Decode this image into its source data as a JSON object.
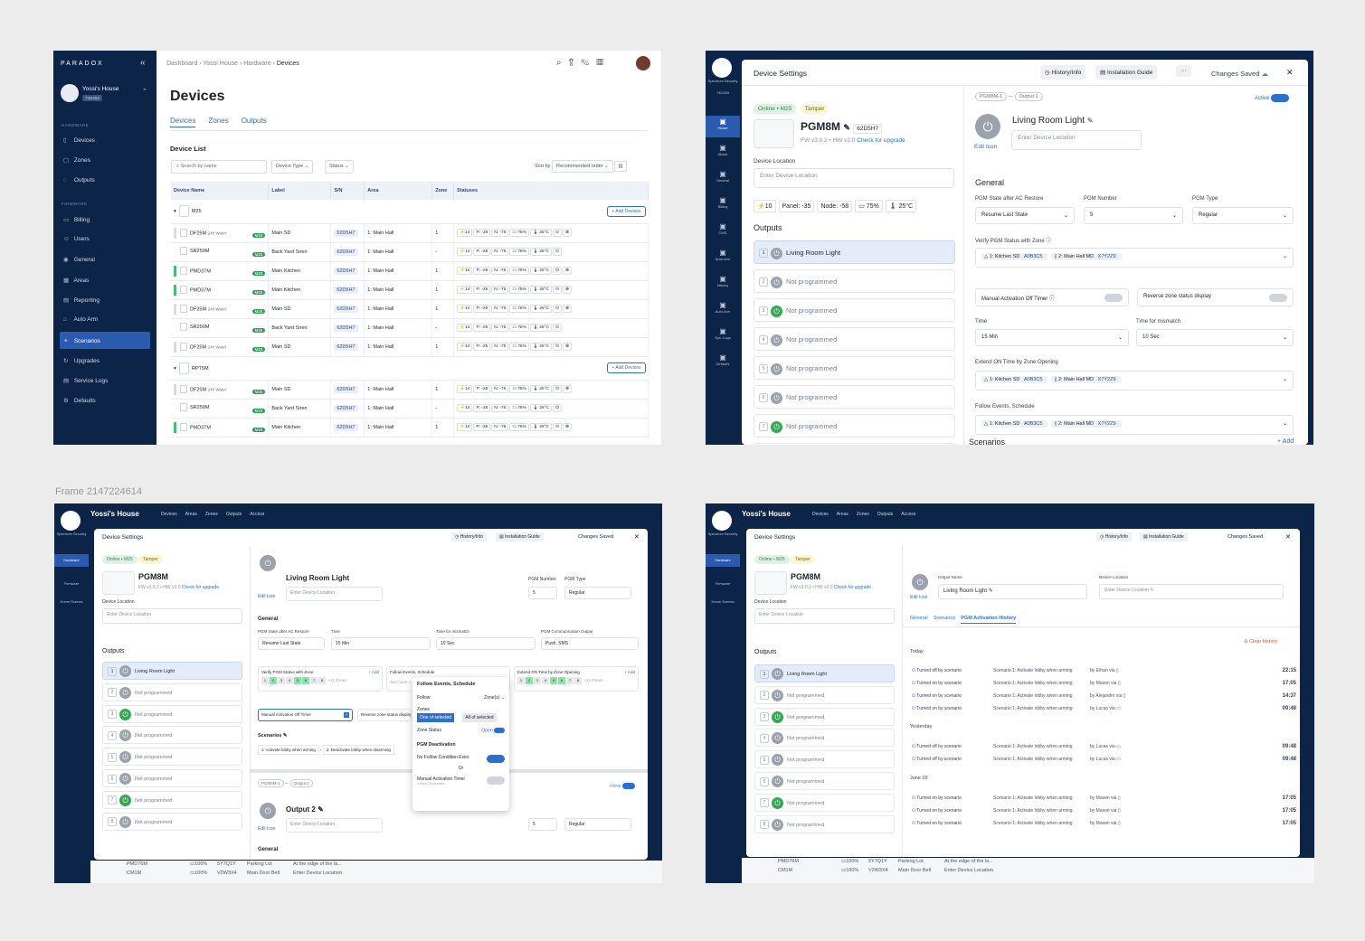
{
  "frame_caption": "Frame 2147224614",
  "f1": {
    "logo": "PARADOX",
    "house": {
      "name": "Yossi's House",
      "id": "74D459"
    },
    "sections": [
      "HARDWARE",
      "FIRMWARE"
    ],
    "nav": [
      {
        "label": "Devices",
        "icon": "▯"
      },
      {
        "label": "Zones",
        "icon": "▢"
      },
      {
        "label": "Outputs",
        "icon": "◌"
      },
      {
        "label": "Billing",
        "icon": "▭"
      },
      {
        "label": "Users",
        "icon": "☺"
      },
      {
        "label": "General",
        "icon": "◉"
      },
      {
        "label": "Areas",
        "icon": "▦"
      },
      {
        "label": "Reporting",
        "icon": "▤"
      },
      {
        "label": "Auto Arm",
        "icon": "⌂"
      },
      {
        "label": "Scenarios",
        "icon": "✦"
      },
      {
        "label": "Upgrades",
        "icon": "↻"
      },
      {
        "label": "Service Logs",
        "icon": "▤"
      },
      {
        "label": "Defaults",
        "icon": "⚙"
      }
    ],
    "breadcrumb": [
      "Dashboard",
      "Yossi House",
      "Hardware",
      "Devices"
    ],
    "title": "Devices",
    "tabs": [
      "Devices",
      "Zones",
      "Outputs"
    ],
    "list_title": "Device List",
    "search_placeholder": "Search by name",
    "filters": [
      "Device Type",
      "Status"
    ],
    "sort_label": "Sort by",
    "sort_value": "Recommended order",
    "columns": [
      "Device Name",
      "Label",
      "S/N",
      "Area",
      "Zone",
      "Statuses"
    ],
    "groups": [
      {
        "name": "M25",
        "add": "+ Add Devices",
        "rows": [
          {
            "n": "DF25M",
            "extra": "24h Water",
            "tag": "M25",
            "label": "Main SD",
            "sn": "62D5H7",
            "area": "1: Main Hall",
            "zone": "1",
            "bar": "x"
          },
          {
            "n": "SR250M",
            "extra": "",
            "tag": "M25",
            "label": "Back Yard Siren",
            "sn": "62D5H7",
            "area": "1: Main Hall",
            "zone": "-",
            "bar": ""
          },
          {
            "n": "PMD37M",
            "extra": "",
            "tag": "M25",
            "label": "Main Kitchen",
            "sn": "62D5H7",
            "area": "1: Main Hall",
            "zone": "1",
            "bar": "g"
          },
          {
            "n": "PMD37M",
            "extra": "",
            "tag": "M25",
            "label": "Main Kitchen",
            "sn": "62D5H7",
            "area": "1: Main Hall",
            "zone": "1",
            "bar": "g"
          },
          {
            "n": "DF25M",
            "extra": "24h Water",
            "tag": "M25",
            "label": "Main SD",
            "sn": "62D5H7",
            "area": "1: Main Hall",
            "zone": "1",
            "bar": "x"
          },
          {
            "n": "SR250M",
            "extra": "",
            "tag": "M25",
            "label": "Back Yard Siren",
            "sn": "62D5H7",
            "area": "1: Main Hall",
            "zone": "-",
            "bar": ""
          },
          {
            "n": "DF25M",
            "extra": "24h Water",
            "tag": "M25",
            "label": "Main SD",
            "sn": "62D5H7",
            "area": "1: Main Hall",
            "zone": "1",
            "bar": "x"
          }
        ]
      },
      {
        "name": "RPT5M",
        "add": "+ Add Devices",
        "rows": [
          {
            "n": "DF25M",
            "extra": "24h Water",
            "tag": "M25",
            "label": "Main SD",
            "sn": "62D5H7",
            "area": "1: Main Hall",
            "zone": "1",
            "bar": "x"
          },
          {
            "n": "SR250M",
            "extra": "",
            "tag": "M25",
            "label": "Back Yard Siren",
            "sn": "62D5H7",
            "area": "1: Main Hall",
            "zone": "-",
            "bar": ""
          },
          {
            "n": "PMD37M",
            "extra": "",
            "tag": "M25",
            "label": "Main Kitchen",
            "sn": "62D5H7",
            "area": "1: Main Hall",
            "zone": "1",
            "bar": "g"
          }
        ]
      }
    ],
    "status_chips": [
      "⚡14",
      "P: -25",
      "N: -75",
      "▭ 75%",
      "🌡 25°C",
      "⊙",
      "⊗"
    ]
  },
  "settings": {
    "brand": "Spectrum Security",
    "brand_id": "74D459",
    "title": "Device Settings",
    "history": "History/Info",
    "guide": "Installation Guide",
    "more": "···",
    "saved": "Changes Saved",
    "close": "✕",
    "online": "Online • M25",
    "tamper": "Tamper",
    "device": "PGM8M",
    "sn": "62D5H7",
    "fw": "FW v3.0.2 • HW v2.0",
    "upgrade": "Check for upgrade",
    "location_label": "Device Location",
    "location_ph": "Enter Device Location",
    "stats": [
      "⚡10",
      "Panel: -35",
      "Node: -58",
      "▭ 75%",
      "🌡 25°C"
    ],
    "outputs_title": "Outputs",
    "outputs": [
      "Living Room Light",
      "Not programmed",
      "Not programmed",
      "Not programmed",
      "Not programmed",
      "Not programmed",
      "Not programmed",
      "Not programmed"
    ],
    "crumb": [
      "PGM8M-1",
      "Output 1"
    ],
    "active": "Active",
    "out_name": "Living Room Light",
    "edit_icon": "Edit Icon",
    "general": "General",
    "ac_label": "PGM State after AC Restore",
    "ac_value": "Resume Last State",
    "pgm_num_label": "PGM Number",
    "pgm_num": "5",
    "pgm_type_label": "PGM Type",
    "pgm_type": "Regular",
    "verify_label": "Verify PGM Status with Zone",
    "zone1": "1: Kitchen SD",
    "zone1_id": "A0B3C5",
    "zone2": "2: Main Hall MD",
    "zone2_id": "X7Y2Z9",
    "manual_label": "Manual Activation Off Timer",
    "reverse_label": "Reverse zone status display",
    "time_label": "Time",
    "time_value": "15 Min",
    "mismatch_label": "Time for mismatch",
    "mismatch_value": "10 Sec",
    "extend_label": "Extend ON Time by Zone Opening",
    "follow_label": "Follow Events, Schedule",
    "scenarios": "Scenarios",
    "add": "+ Add",
    "nav2": [
      "Home",
      "About",
      "General",
      "Billing",
      "CMS",
      "Auto Arm",
      "History",
      "Auto Arm",
      "Sys. Logs",
      "Defaults"
    ]
  },
  "f3": {
    "house": "Yossi's House",
    "topnav": [
      "Devices",
      "Areas",
      "Zones",
      "Outputs",
      "Access"
    ],
    "nav": [
      "Hardware",
      "Firmware",
      "Home Scenes"
    ],
    "comm_label": "PGM Communication Output",
    "comm_value": "Push, SMS",
    "verify_add": "+ Add",
    "zone_count": "+12 Zones",
    "zones_nums": [
      "1",
      "2",
      "3",
      "4",
      "5",
      "6",
      "7",
      "8"
    ],
    "popup": {
      "title": "Follow Events, Schedule",
      "follow": "Follow",
      "follow_val": "Zone(s)",
      "zones": "Zones",
      "one": "One of selected",
      "all": "All of selected",
      "zone_status": "Zone Status",
      "open": "Open",
      "deact": "PGM Deactivation",
      "no_follow": "No Follow Condition Exist",
      "or": "Or",
      "manual": "Manual Activation Timer",
      "manual_sub": "1 hour 15 minutes"
    },
    "follow_ph": "See more c...",
    "scen": [
      "1: Activate lobby when arming",
      "2: Deactivate lobby when disarming"
    ],
    "out2": "Output 2",
    "out2_crumb": [
      "PGM8M-1",
      "Output 2"
    ],
    "bottom_rows": [
      {
        "n": "PMD76M",
        "b": "▭100%",
        "sn": "5Y7Q1Y",
        "l": "Parking Lot",
        "d": "At the edge of the la..."
      },
      {
        "n": "CM1M",
        "b": "▭100%",
        "sn": "V2W3X4",
        "l": "Main Door Bell",
        "d": "Enter Device Location"
      }
    ]
  },
  "f4": {
    "outname_label": "Output Name",
    "dev_loc_label": "Device Location",
    "tabs": [
      "General",
      "Scenarios",
      "PGM Activation History"
    ],
    "clear": "Clear history",
    "days": [
      "Today",
      "Yesterday",
      "June 03"
    ],
    "rows": [
      [
        {
          "a": "Turned off by scenario",
          "b": "Scenario 1: Activate lobby when arming",
          "u": "by Ethan via ▯",
          "t": "22:15"
        },
        {
          "a": "Turned on by scenario",
          "b": "Scenario 1: Activate lobby when arming",
          "u": "by Mason via ▯",
          "t": "17:05"
        },
        {
          "a": "Turned on by scenario",
          "b": "Scenario 1: Activate lobby when arming",
          "u": "by Alejandro via ▯",
          "t": "14:37"
        },
        {
          "a": "Turned on by scenario",
          "b": "Scenario 1: Activate lobby when arming",
          "u": "by Lucas via ▭",
          "t": "09:48"
        }
      ],
      [
        {
          "a": "Turned off by scenario",
          "b": "Scenario 1: Activate lobby when arming",
          "u": "by Lucas via ▭",
          "t": "09:48"
        },
        {
          "a": "Turned off by scenario",
          "b": "Scenario 1: Activate lobby when arming",
          "u": "by Lucas via ▭",
          "t": "09:48"
        }
      ],
      [
        {
          "a": "Turned on by scenario",
          "b": "Scenario 1: Activate lobby when arming",
          "u": "by Mason via ▯",
          "t": "17:05"
        },
        {
          "a": "Turned on by scenario",
          "b": "Scenario 1: Activate lobby when arming",
          "u": "by Mason via ▯",
          "t": "17:05"
        },
        {
          "a": "Turned on by scenario",
          "b": "Scenario 1: Activate lobby when arming",
          "u": "by Mason via ▯",
          "t": "17:05"
        }
      ]
    ]
  }
}
